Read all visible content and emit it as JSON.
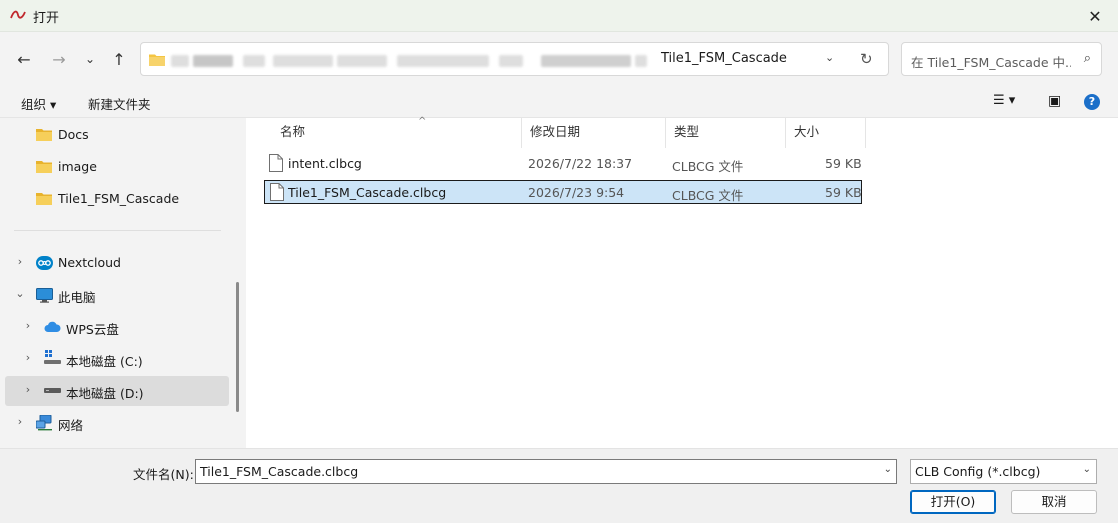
{
  "window": {
    "title": "打开",
    "close_glyph": "✕"
  },
  "nav": {
    "back_icon": "←",
    "forward_icon": "→",
    "recent_icon": "⌄",
    "up_icon": "↑",
    "address_current": "Tile1_FSM_Cascade",
    "address_dropdown": "⌄",
    "refresh_icon": "↻",
    "search_placeholder": "在 Tile1_FSM_Cascade 中...",
    "search_icon": "⌕"
  },
  "toolbar": {
    "organize": "组织 ▾",
    "new_folder": "新建文件夹",
    "view_icon": "☰ ▾",
    "preview_icon": "▣",
    "help": "?"
  },
  "sidebar": {
    "quick": [
      {
        "label": "Docs",
        "icon": "folder-icon"
      },
      {
        "label": "image",
        "icon": "folder-icon"
      },
      {
        "label": "Tile1_FSM_Cascade",
        "icon": "folder-icon"
      }
    ],
    "tree": [
      {
        "label": "Nextcloud",
        "chevron": "›",
        "icon": "nextcloud-icon",
        "indent": 0
      },
      {
        "label": "此电脑",
        "chevron": "⌄",
        "icon": "computer-icon",
        "indent": 0
      },
      {
        "label": "WPS云盘",
        "chevron": "›",
        "icon": "cloud-icon",
        "indent": 1
      },
      {
        "label": "本地磁盘 (C:)",
        "chevron": "›",
        "icon": "drive-c-icon",
        "indent": 1
      },
      {
        "label": "本地磁盘 (D:)",
        "chevron": "›",
        "icon": "drive-icon",
        "indent": 1,
        "selected": true
      },
      {
        "label": "网络",
        "chevron": "›",
        "icon": "network-icon",
        "indent": 0
      }
    ]
  },
  "columns": {
    "name": "名称",
    "date": "修改日期",
    "type": "类型",
    "size": "大小",
    "sort_caret": "^"
  },
  "files": [
    {
      "name": "intent.clbcg",
      "date": "2026/7/22 18:37",
      "type": "CLBCG 文件",
      "size": "59 KB",
      "selected": false
    },
    {
      "name": "Tile1_FSM_Cascade.clbcg",
      "date": "2026/7/23 9:54",
      "type": "CLBCG 文件",
      "size": "59 KB",
      "selected": true
    }
  ],
  "bottom": {
    "filename_label": "文件名(N):",
    "filename_value": "Tile1_FSM_Cascade.clbcg",
    "filter_value": "CLB Config (*.clbcg)",
    "dropdown_glyph": "⌄",
    "open_button": "打开(O)",
    "cancel_button": "取消"
  },
  "colors": {
    "accent": "#0067c0",
    "selection": "#cce4f7",
    "folder": "#f4c542"
  }
}
